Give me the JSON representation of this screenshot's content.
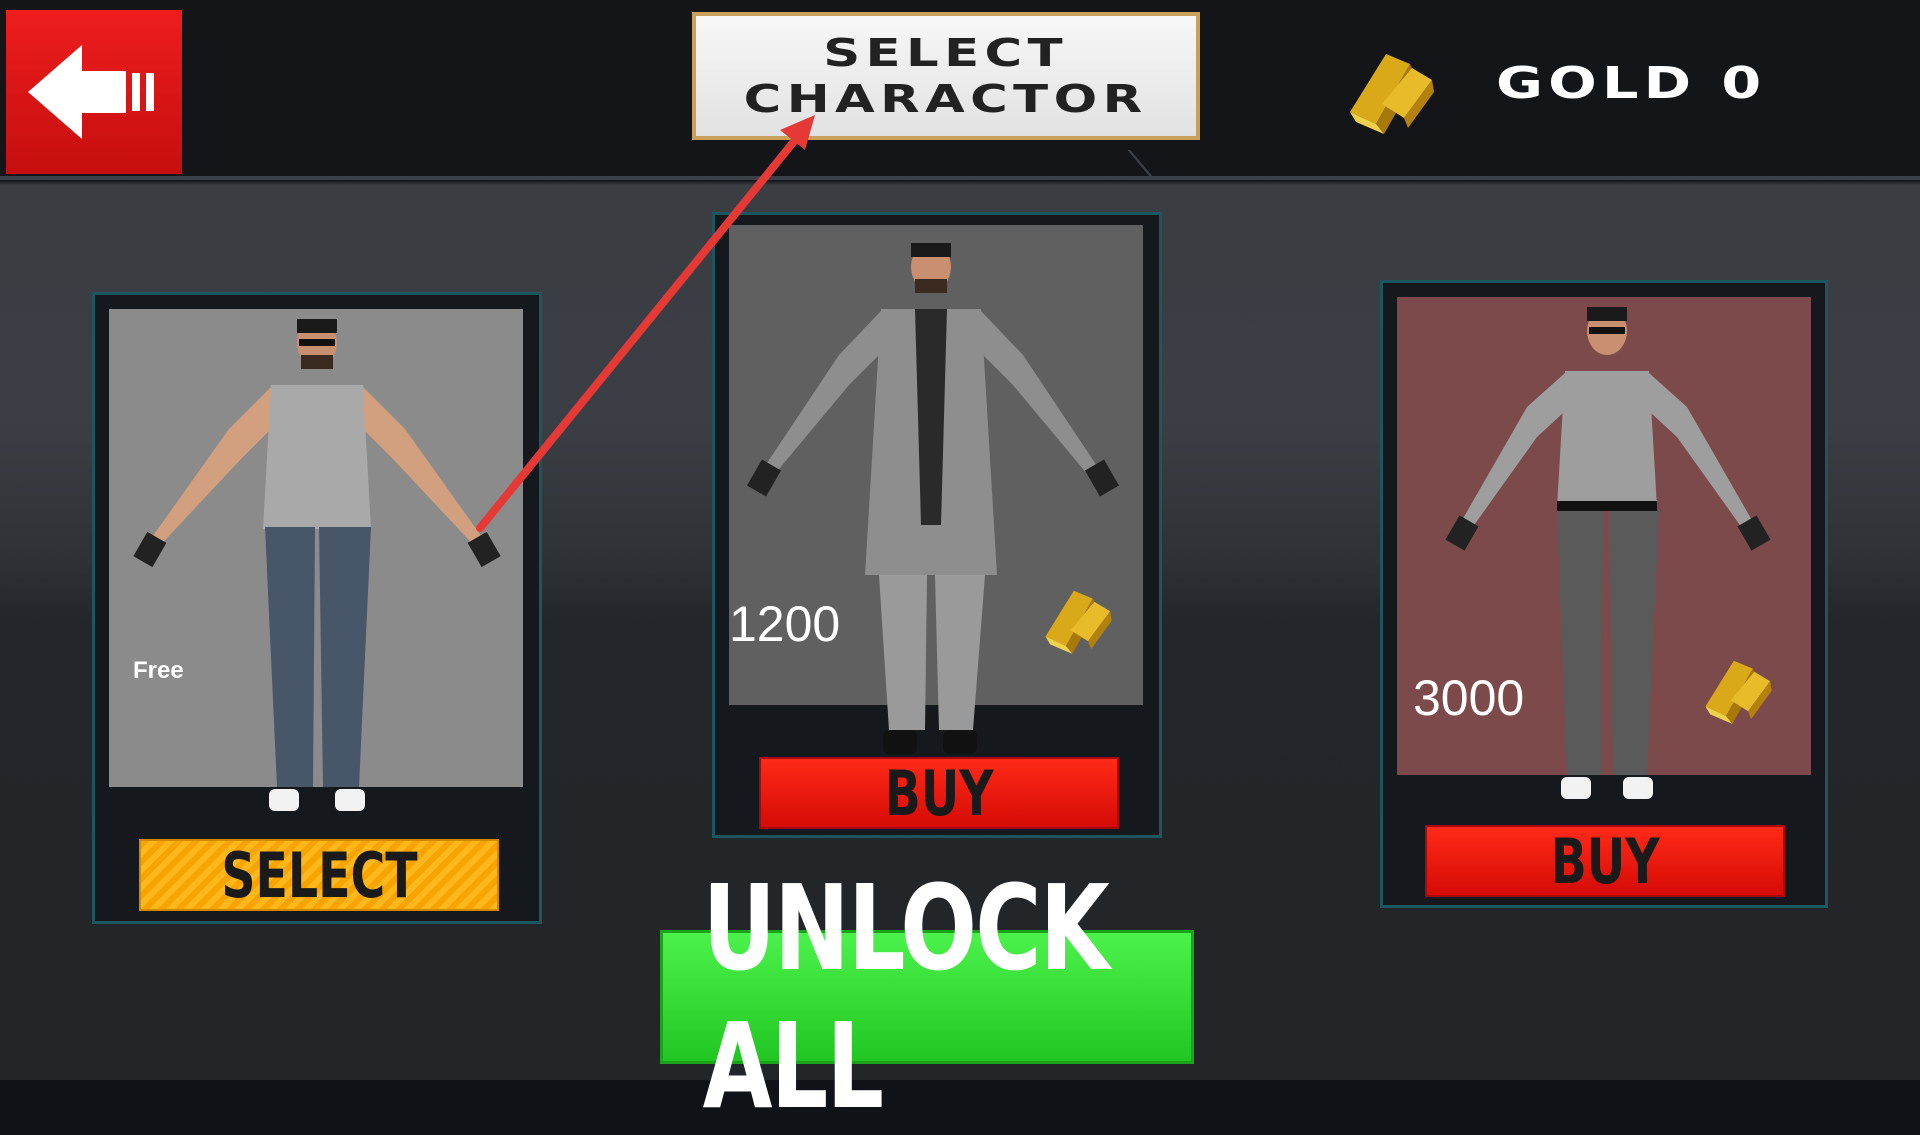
{
  "header": {
    "title": "SELECT\nCHARACTOR",
    "gold_label": "GOLD 0"
  },
  "icons": {
    "back": "back-arrow-icon",
    "gold": "gold-bar-icon"
  },
  "characters": [
    {
      "price_label": "Free",
      "button_label": "SELECT",
      "background": "#8b8b8b"
    },
    {
      "price_label": "1200",
      "button_label": "BUY",
      "background": "#606060"
    },
    {
      "price_label": "3000",
      "button_label": "BUY",
      "background": "#7c4a4a"
    }
  ],
  "unlock_all_label": "UNLOCK ALL",
  "colors": {
    "back_button": "#e01515",
    "select_button": "#f7a400",
    "buy_button": "#e61a10",
    "unlock_button": "#33dd33",
    "annotation_arrow": "#e53935"
  }
}
